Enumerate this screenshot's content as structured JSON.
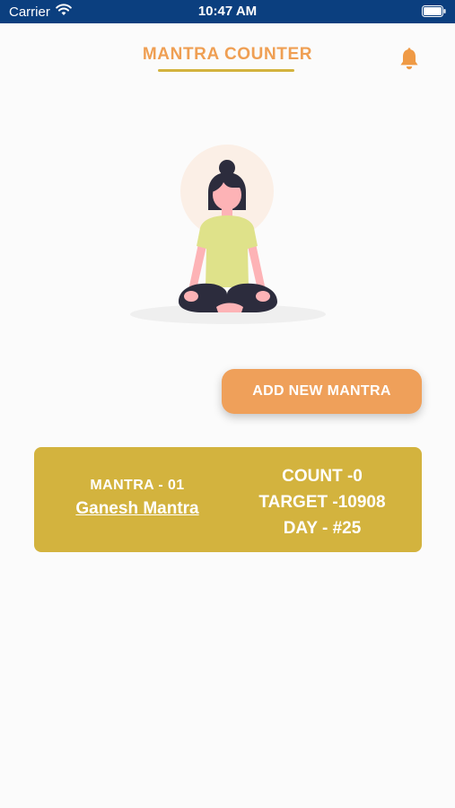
{
  "status_bar": {
    "carrier": "Carrier",
    "time": "10:47 AM"
  },
  "header": {
    "title": "MANTRA COUNTER",
    "notification_icon": "bell-icon"
  },
  "illustration": {
    "icon": "meditating-person-illustration"
  },
  "actions": {
    "add_mantra_label": "ADD NEW MANTRA"
  },
  "mantra_card": {
    "number_label": "MANTRA - 01",
    "name": "Ganesh Mantra",
    "count_label": "COUNT -0",
    "target_label": "TARGET -10908",
    "day_label": "DAY - #25"
  },
  "colors": {
    "status_bar": "#0b3f7f",
    "accent_orange": "#efa05a",
    "card_gold": "#d3b33e",
    "background": "#fbfbfb"
  }
}
